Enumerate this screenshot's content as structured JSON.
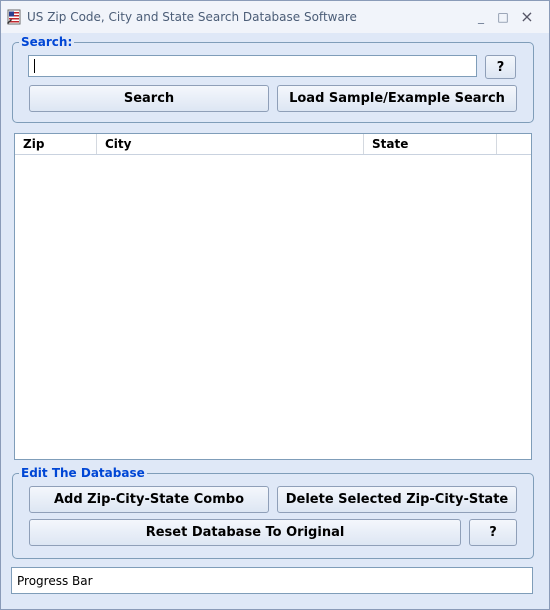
{
  "window": {
    "title": "US Zip Code, City and State Search Database Software",
    "minimize_glyph": "_",
    "maximize_glyph": "□",
    "close_glyph": "×",
    "icon": "us-flag-document-icon"
  },
  "search": {
    "group_label": "Search:",
    "input_value": "",
    "help_label": "?",
    "search_label": "Search",
    "sample_label": "Load Sample/Example Search"
  },
  "results": {
    "columns": [
      "Zip",
      "City",
      "State"
    ],
    "rows": []
  },
  "edit": {
    "group_label": "Edit The Database",
    "add_label": "Add Zip-City-State Combo",
    "delete_label": "Delete Selected Zip-City-State",
    "reset_label": "Reset Database To Original",
    "help_label": "?"
  },
  "status": {
    "text": "Progress Bar"
  },
  "colors": {
    "window_bg": "#dfe8f7",
    "group_label": "#0046d5",
    "border": "#7f9db9"
  }
}
